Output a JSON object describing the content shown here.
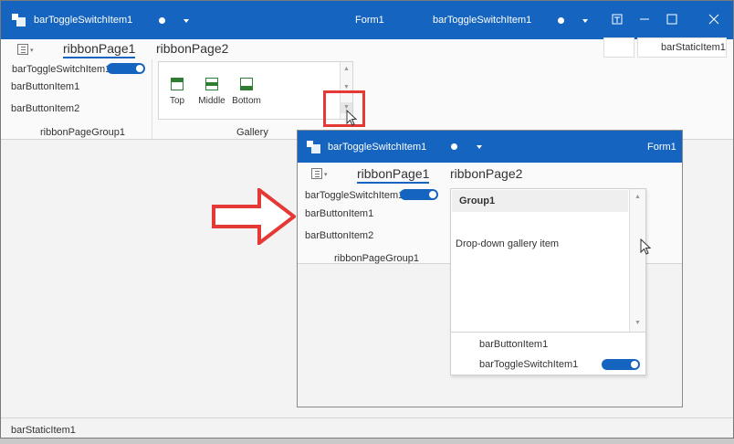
{
  "back_window": {
    "title_left": "barToggleSwitchItem1",
    "title_center": "Form1",
    "title_right": "barToggleSwitchItem1",
    "tabs": [
      "ribbonPage1",
      "ribbonPage2"
    ],
    "static_item_top": "barStaticItem1",
    "toggle_label": "barToggleSwitchItem1",
    "button1": "barButtonItem1",
    "button2": "barButtonItem2",
    "group_label": "ribbonPageGroup1",
    "gallery_label": "Gallery",
    "gallery_items": [
      "Top",
      "Middle",
      "Bottom"
    ],
    "status_item": "barStaticItem1"
  },
  "front_window": {
    "title_left": "barToggleSwitchItem1",
    "title_right": "Form1",
    "tabs": [
      "ribbonPage1",
      "ribbonPage2"
    ],
    "toggle_label": "barToggleSwitchItem1",
    "button1": "barButtonItem1",
    "button2": "barButtonItem2",
    "group_label": "ribbonPageGroup1"
  },
  "dropdown": {
    "group_header": "Group1",
    "gallery_item": "Drop-down gallery item",
    "menu_items": [
      "barButtonItem1",
      "barToggleSwitchItem1"
    ]
  },
  "colors": {
    "accent": "#1565c0",
    "highlight": "#e53935",
    "gallery_icon": "#2e7d32"
  },
  "icons": {
    "title_controls": [
      "dot-icon",
      "caret-down-icon",
      "pin-icon",
      "minimize-icon",
      "maximize-icon",
      "close-icon"
    ],
    "annotation": "arrow-right-icon"
  }
}
